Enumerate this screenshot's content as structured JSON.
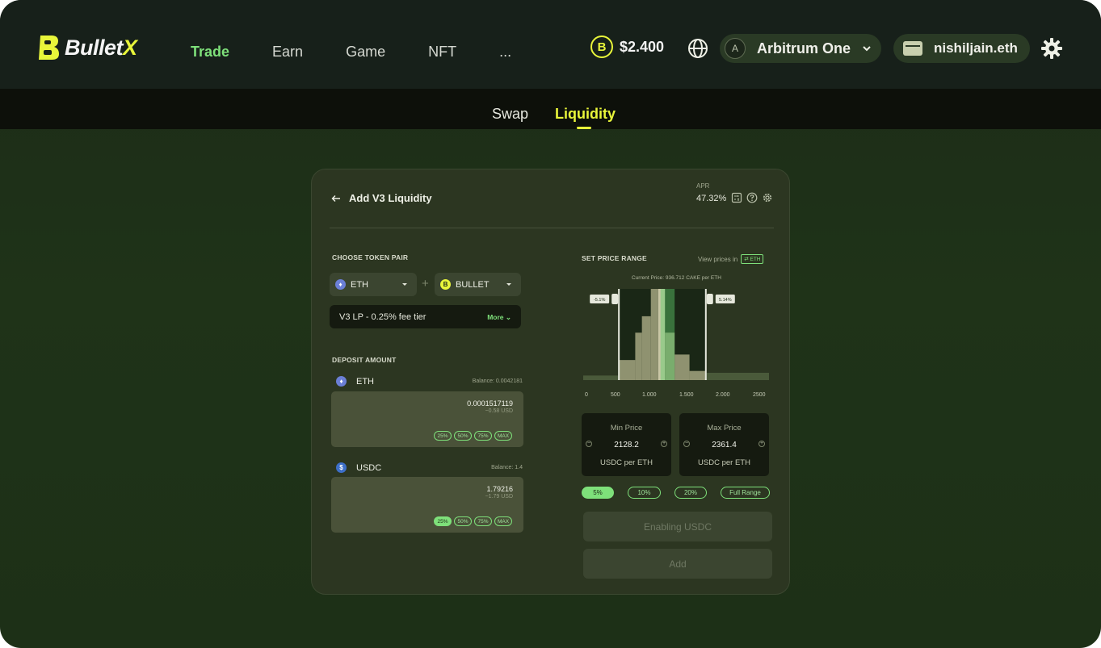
{
  "brand": {
    "name_main": "Bullet",
    "name_accent": "X"
  },
  "nav": {
    "items": [
      "Trade",
      "Earn",
      "Game",
      "NFT",
      "..."
    ]
  },
  "header": {
    "price": "$2.400",
    "network": "Arbitrum One",
    "wallet": "nishiljain.eth"
  },
  "subtabs": {
    "swap": "Swap",
    "liquidity": "Liquidity"
  },
  "card": {
    "title": "Add V3 Liquidity",
    "apr_label": "APR",
    "apr_value": "47.32%"
  },
  "token_pair": {
    "label": "CHOOSE TOKEN PAIR",
    "token_a": "ETH",
    "token_b": "BULLET",
    "fee_tier": "V3 LP - 0.25% fee tier",
    "more": "More"
  },
  "deposit": {
    "label": "DEPOSIT AMOUNT",
    "rows": [
      {
        "token": "ETH",
        "balance": "Balance: 0.0042181",
        "amount": "0.0001517119",
        "usd": "~0.58 USD",
        "pcts": [
          "25%",
          "50%",
          "75%",
          "MAX"
        ],
        "active": -1
      },
      {
        "token": "USDC",
        "balance": "Balance: 1.4",
        "amount": "1.79216",
        "usd": "~1.79 USD",
        "pcts": [
          "25%",
          "50%",
          "75%",
          "MAX"
        ],
        "active": 0
      }
    ]
  },
  "price_range": {
    "label": "SET PRICE RANGE",
    "view_prices": "View prices in",
    "view_token": "ETH",
    "current_price": "Current Price: 936.712 CAKE per ETH",
    "handle_left": "-5.1%",
    "handle_right": "5.14%",
    "min_label": "Min Price",
    "min_value": "2128.2",
    "min_unit": "USDC per ETH",
    "max_label": "Max Price",
    "max_value": "2361.4",
    "max_unit": "USDC per ETH",
    "buttons": [
      "5%",
      "10%",
      "20%",
      "Full Range"
    ],
    "active_button": 0,
    "enable_label": "Enabling USDC",
    "add_label": "Add"
  },
  "chart_data": {
    "type": "bar",
    "title": "",
    "xlabel": "",
    "ylabel": "",
    "x_ticks": [
      "0",
      "500",
      "1.000",
      "1.500",
      "2.000",
      "2500"
    ],
    "xlim": [
      0,
      2500
    ],
    "selected_range": [
      480,
      1650
    ],
    "current_price": 1040,
    "bins": [
      {
        "x0": 0,
        "x1": 480,
        "value": 5
      },
      {
        "x0": 480,
        "x1": 700,
        "value": 22
      },
      {
        "x0": 700,
        "x1": 790,
        "value": 52
      },
      {
        "x0": 790,
        "x1": 910,
        "value": 70
      },
      {
        "x0": 910,
        "x1": 1010,
        "value": 100
      },
      {
        "x0": 1010,
        "x1": 1100,
        "value": 100
      },
      {
        "x0": 1100,
        "x1": 1230,
        "value": 52
      },
      {
        "x0": 1230,
        "x1": 1430,
        "value": 28
      },
      {
        "x0": 1430,
        "x1": 1650,
        "value": 10
      },
      {
        "x0": 1650,
        "x1": 2500,
        "value": 8
      }
    ]
  }
}
